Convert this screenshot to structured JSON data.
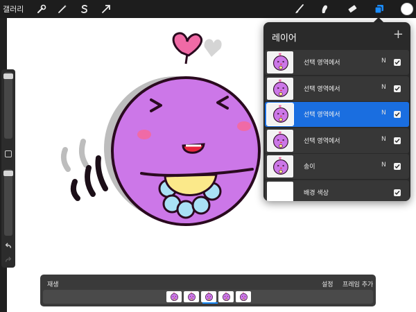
{
  "topbar": {
    "gallery_label": "갤러리",
    "left_tools": [
      {
        "name": "adjustments-wrench-icon"
      },
      {
        "name": "magic-wand-icon"
      },
      {
        "name": "selection-s-icon"
      },
      {
        "name": "transform-arrow-icon"
      }
    ],
    "right_tools": [
      {
        "name": "brush-icon"
      },
      {
        "name": "smudge-icon"
      },
      {
        "name": "eraser-icon"
      },
      {
        "name": "layers-icon",
        "active": true
      }
    ],
    "current_color": "#ffffff"
  },
  "layers_panel": {
    "title": "레이어",
    "add_symbol": "+",
    "layers": [
      {
        "name": "선택 영역에서",
        "mode": "N",
        "visible": true,
        "selected": false
      },
      {
        "name": "선택 영역에서",
        "mode": "N",
        "visible": true,
        "selected": false
      },
      {
        "name": "선택 영역에서",
        "mode": "N",
        "visible": true,
        "selected": true
      },
      {
        "name": "선택 영역에서",
        "mode": "N",
        "visible": true,
        "selected": false
      },
      {
        "name": "송이",
        "mode": "N",
        "visible": true,
        "selected": false
      },
      {
        "name": "배경 색상",
        "mode": "",
        "visible": true,
        "selected": false
      }
    ]
  },
  "animation": {
    "playback_label": "재생",
    "settings_label": "설정",
    "add_frame_label": "프레임 추가",
    "frame_count": 5
  },
  "colors": {
    "accent": "#1a6ee0",
    "character_fill": "#cc77e8",
    "outline": "#2a0a1f",
    "heart": "#f06aa6",
    "bib": "#fbe98a",
    "collar": "#a9e0f5"
  }
}
